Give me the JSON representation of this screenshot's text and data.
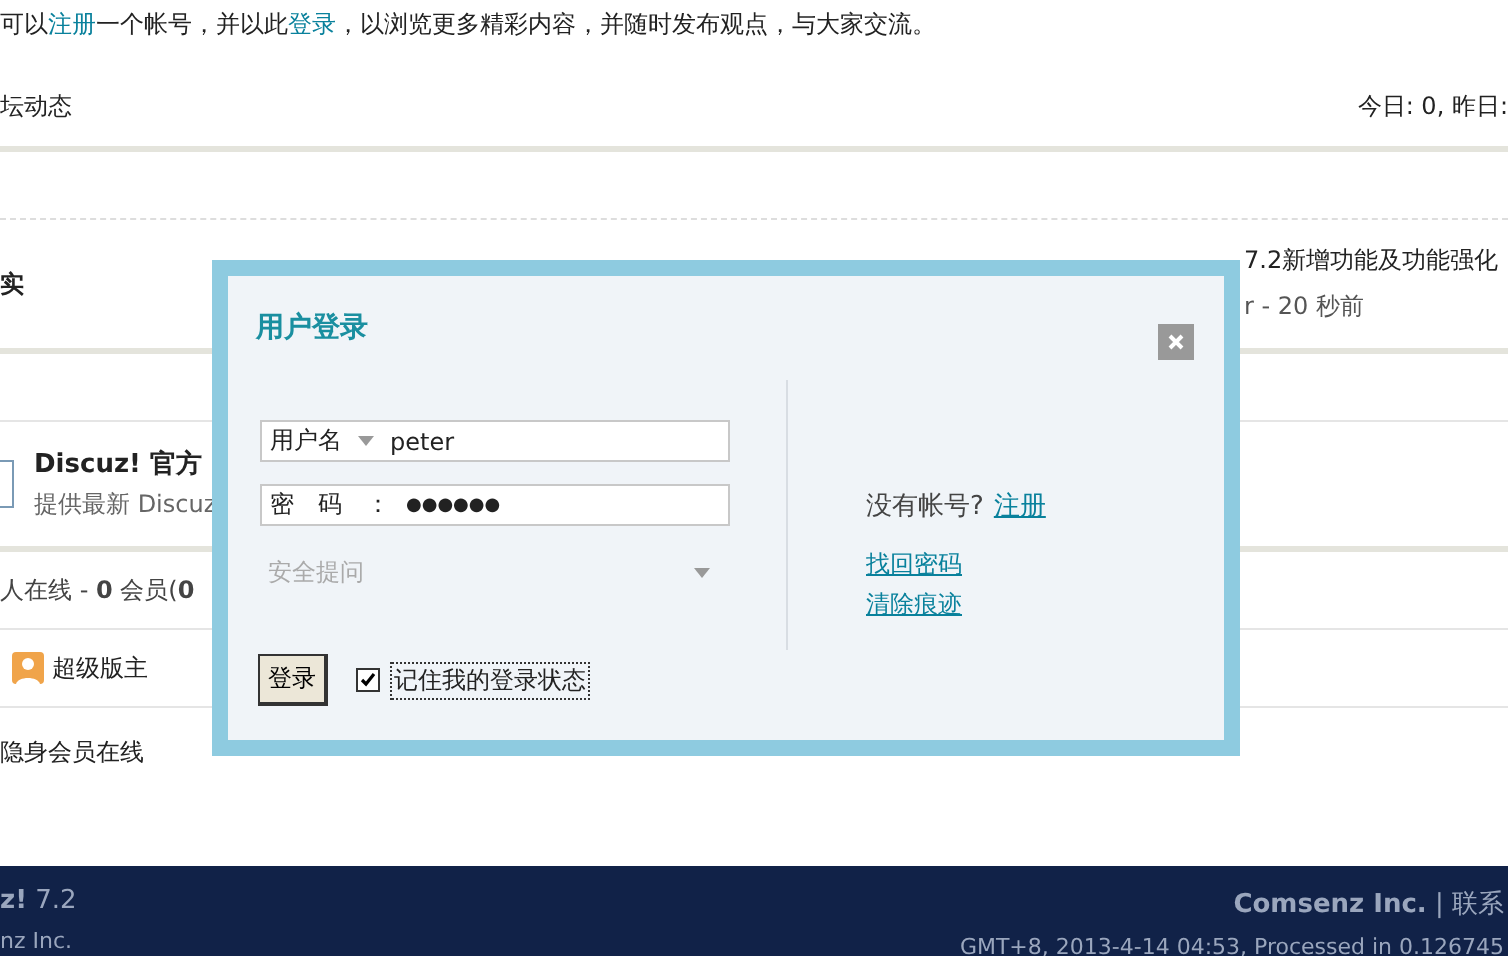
{
  "intro": [
    {
      "kind": "text",
      "text": "可以"
    },
    {
      "kind": "link",
      "text": "注册"
    },
    {
      "kind": "text",
      "text": "一个帐号，并以此"
    },
    {
      "kind": "link",
      "text": "登录"
    },
    {
      "kind": "text",
      "text": "，以浏览更多精彩内容，并随时发布观点，与大家交流。"
    }
  ],
  "stats_bar": {
    "title": "坛动态",
    "counts": "今日: 0, 昨日:"
  },
  "thread": {
    "title": "实",
    "latest_title": "7.2新增功能及功能强化",
    "latest_meta": "r - 20 秒前"
  },
  "forum": {
    "name": "Discuz! 官方",
    "description": "提供最新 Discuz"
  },
  "online": {
    "summary": "人在线 - **0** 会员(**0**",
    "legend": [
      {
        "label": "超级版主"
      }
    ],
    "note": "隐身会员在线"
  },
  "footer": {
    "brand": "**z!** 7.2",
    "copyright": "nz Inc.",
    "company": "**Comsenz Inc.** | 联系",
    "time": "GMT+8, 2013-4-14 04:53, Processed in 0.126745"
  },
  "login_dialog": {
    "title": "用户登录",
    "username": {
      "label": "用户名",
      "value": "peter"
    },
    "password": {
      "label": "密　码　：",
      "value": "●●●●●●"
    },
    "security_question": {
      "placeholder": "安全提问"
    },
    "submit": "登录",
    "remember": {
      "label": "记住我的登录状态",
      "checked": true
    },
    "no_account": "没有帐号?",
    "register": "注册",
    "links": [
      "找回密码",
      "清除痕迹"
    ]
  }
}
